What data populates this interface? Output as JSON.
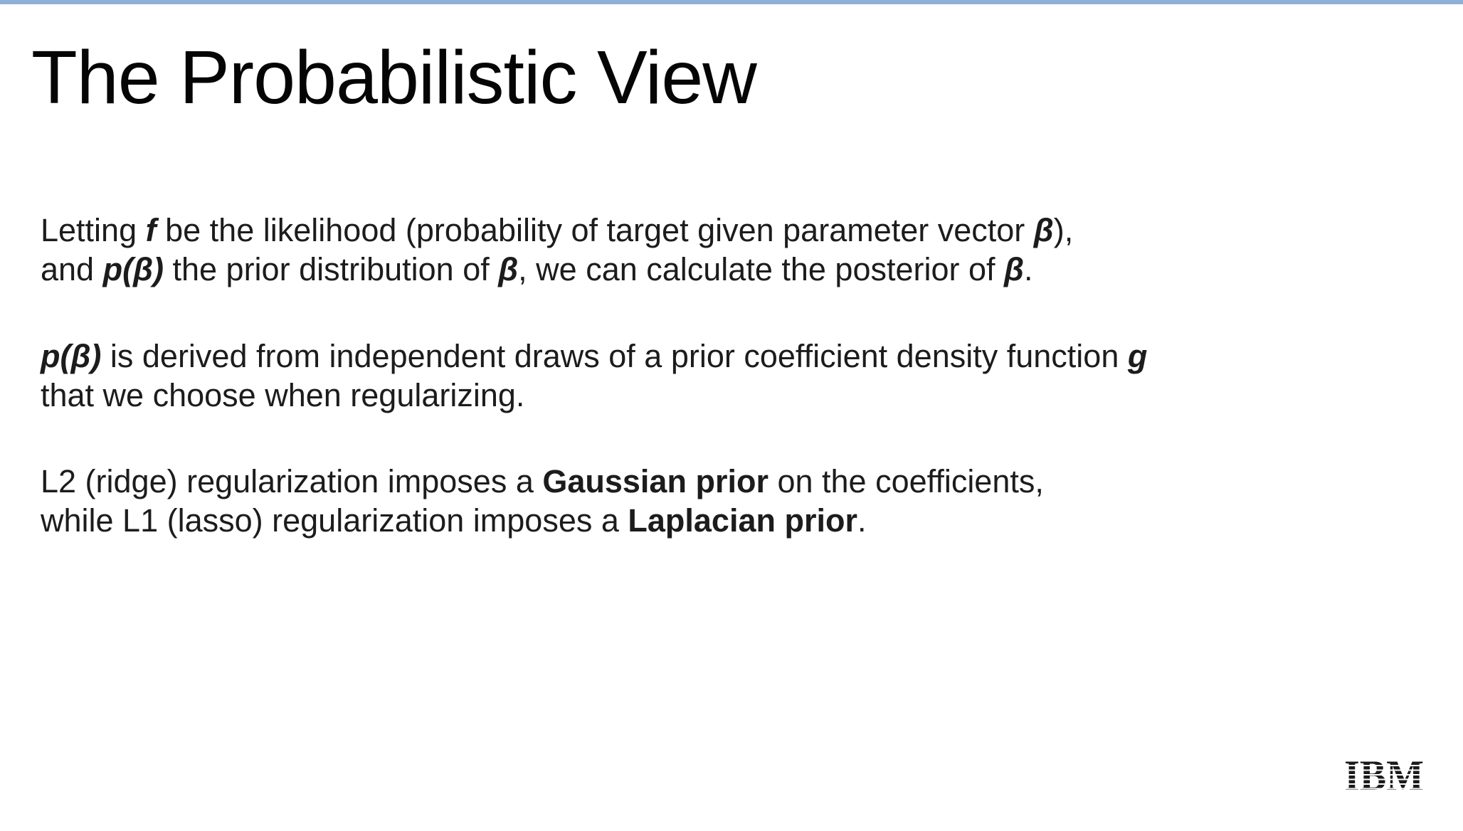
{
  "slide": {
    "title": "The Probabilistic View",
    "paragraphs": [
      {
        "line1": {
          "t1": "Letting ",
          "f": "f",
          "t2": " be the likelihood (probability of target given parameter vector ",
          "beta1": "β",
          "t3": "),"
        },
        "line2": {
          "t1": "and ",
          "pbeta": "p(β)",
          "t2": " the prior distribution of ",
          "beta2": "β",
          "t3": ", we can calculate the posterior of ",
          "beta3": "β",
          "t4": "."
        }
      },
      {
        "line1": {
          "pbeta": "p(β)",
          "t1": " is derived from independent draws of a prior coefficient density function ",
          "g": "g"
        },
        "line2": {
          "t1": "that we choose when regularizing."
        }
      },
      {
        "line1": {
          "t1": "L2 (ridge) regularization imposes a ",
          "gaussian": "Gaussian prior",
          "t2": " on the coefficients,"
        },
        "line2": {
          "t1": "while L1 (lasso) regularization imposes a ",
          "laplacian": "Laplacian prior",
          "t2": "."
        }
      }
    ]
  },
  "logo": {
    "text": "IBM",
    "icon": "ibm-logo"
  },
  "colors": {
    "top_rule": "#8fb0d6",
    "text": "#1c1c1c",
    "title": "#050505"
  }
}
